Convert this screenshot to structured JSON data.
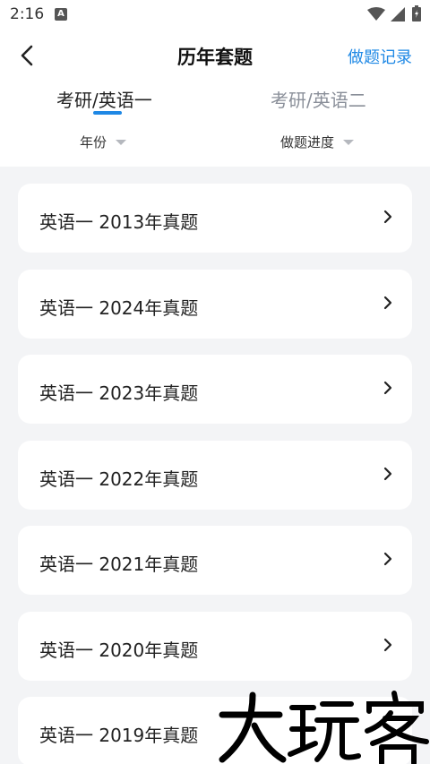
{
  "status_bar": {
    "time": "2:16",
    "notification_letter": "A"
  },
  "nav": {
    "title": "历年套题",
    "record_link": "做题记录"
  },
  "tabs": [
    {
      "label": "考研/英语一",
      "active": true
    },
    {
      "label": "考研/英语二",
      "active": false
    }
  ],
  "filters": {
    "year": "年份",
    "progress": "做题进度"
  },
  "items": [
    {
      "label": "英语一 2013年真题"
    },
    {
      "label": "英语一 2024年真题"
    },
    {
      "label": "英语一 2023年真题"
    },
    {
      "label": "英语一 2022年真题"
    },
    {
      "label": "英语一 2021年真题"
    },
    {
      "label": "英语一 2020年真题"
    },
    {
      "label": "英语一 2019年真题"
    }
  ],
  "watermark": {
    "text": "大玩客"
  },
  "colors": {
    "accent": "#1e88e5",
    "background": "#f3f4f6",
    "card": "#ffffff",
    "inactive_tab": "#8a8f99"
  },
  "icons": {
    "back": "chevron-left-icon",
    "item_arrow": "chevron-right-icon"
  }
}
